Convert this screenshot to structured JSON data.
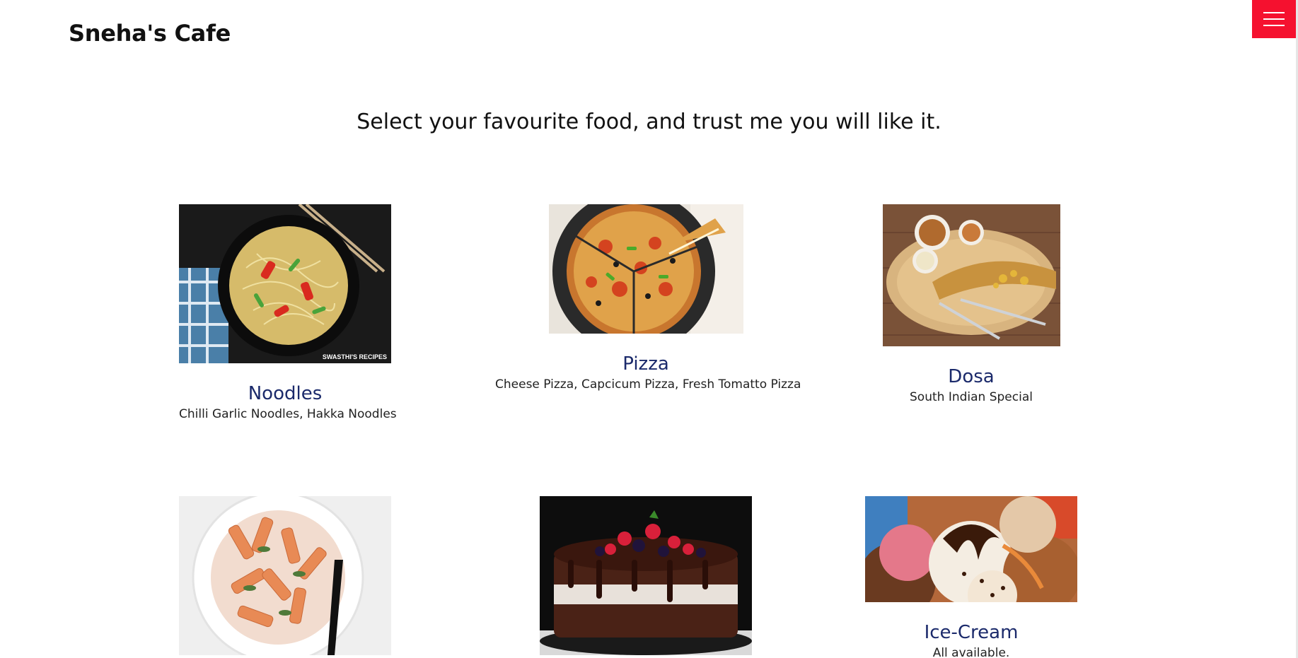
{
  "header": {
    "brand": "Sneha's Cafe",
    "menu_icon": "hamburger-menu-icon",
    "menu_color": "#f5112f"
  },
  "main": {
    "headline": "Select your favourite food, and trust me you will like it."
  },
  "foods": [
    {
      "name": "Noodles",
      "description": "Chilli Garlic Noodles, Hakka Noodles",
      "image_watermark": "SWASTHI'S RECIPES"
    },
    {
      "name": "Pizza",
      "description": "Cheese Pizza, Capcicum Pizza, Fresh Tomatto Pizza"
    },
    {
      "name": "Dosa",
      "description": "South Indian Special"
    },
    {
      "name": "",
      "description": ""
    },
    {
      "name": "",
      "description": ""
    },
    {
      "name": "Ice-Cream",
      "description": "All available."
    }
  ],
  "colors": {
    "title_blue": "#1b2a6b",
    "accent_red": "#f5112f"
  }
}
